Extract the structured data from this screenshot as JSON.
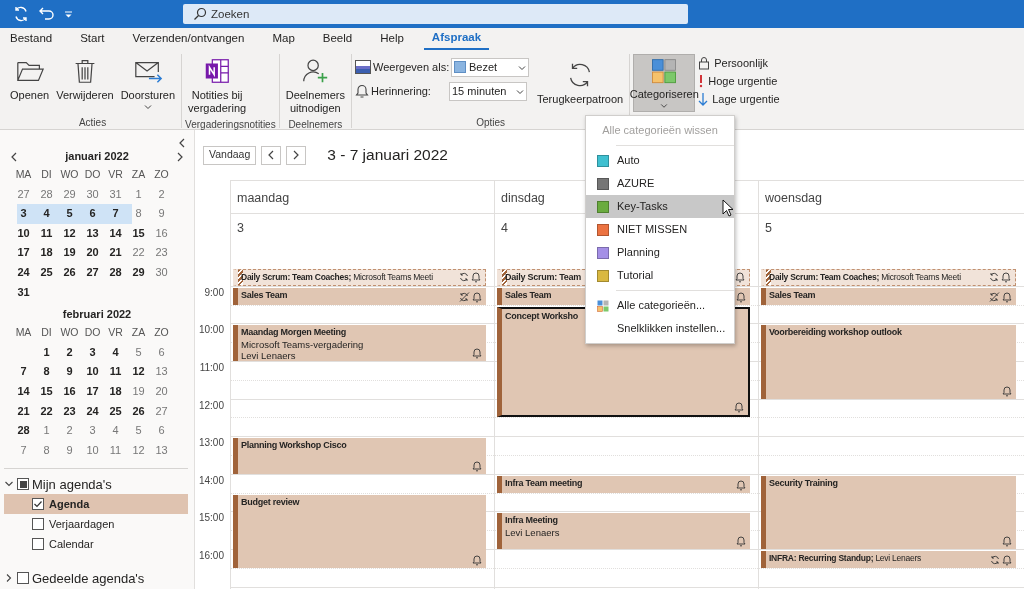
{
  "titlebar": {
    "search": {
      "placeholder": "Zoeken"
    }
  },
  "tabs": [
    {
      "label": "Bestand",
      "selected": false
    },
    {
      "label": "Start",
      "selected": false
    },
    {
      "label": "Verzenden/ontvangen",
      "selected": false
    },
    {
      "label": "Map",
      "selected": false
    },
    {
      "label": "Beeld",
      "selected": false
    },
    {
      "label": "Help",
      "selected": false
    },
    {
      "label": "Afspraak",
      "selected": true
    }
  ],
  "ribbon": {
    "groups": [
      {
        "kind": "large",
        "label": "Acties",
        "buttons": [
          {
            "kind": "open",
            "label": "Openen",
            "caret": false,
            "pressed": false
          },
          {
            "kind": "delete",
            "label": "Verwijderen",
            "caret": false,
            "pressed": false
          },
          {
            "kind": "forward",
            "label": "Doorsturen",
            "caret": true,
            "pressed": false
          }
        ]
      },
      {
        "kind": "large",
        "label": "Vergaderingsnotities",
        "buttons": [
          {
            "kind": "notes",
            "label": "Notities bij\nvergadering",
            "caret": false,
            "pressed": false
          }
        ]
      },
      {
        "kind": "large",
        "label": "Deelnemers",
        "buttons": [
          {
            "kind": "invite",
            "label": "Deelnemers\nuitnodigen",
            "caret": false,
            "pressed": false
          }
        ]
      },
      {
        "kind": "options",
        "label": "Opties",
        "fields": [
          {
            "kind": "show-as",
            "label": "Weergeven als:",
            "value": "Bezet"
          },
          {
            "kind": "reminder",
            "label": "Herinnering:",
            "value": "15 minuten"
          }
        ],
        "buttons": [
          {
            "kind": "recurrence",
            "label": "Terugkeerpatroon",
            "caret": false,
            "pressed": false
          }
        ]
      },
      {
        "kind": "categorize",
        "buttons": [
          {
            "kind": "categorize",
            "label": "Categoriseren",
            "caret": true,
            "pressed": true
          }
        ],
        "small_buttons": [
          {
            "kind": "private",
            "label": "Persoonlijk"
          },
          {
            "kind": "high",
            "label": "Hoge urgentie"
          },
          {
            "kind": "low",
            "label": "Lage urgentie"
          }
        ]
      }
    ]
  },
  "category_menu": {
    "items": [
      {
        "kind": "command",
        "label": "Alle categorieën wissen",
        "disabled": true,
        "hovered": false
      },
      {
        "kind": "separator"
      },
      {
        "kind": "category",
        "label": "Auto",
        "color": "#3fc0d0",
        "hovered": false
      },
      {
        "kind": "category",
        "label": "AZURE",
        "color": "#767676",
        "hovered": false
      },
      {
        "kind": "category",
        "label": "Key-Tasks",
        "color": "#6aab3f",
        "hovered": true
      },
      {
        "kind": "category",
        "label": "NIET MISSEN",
        "color": "#ec7341",
        "hovered": false
      },
      {
        "kind": "category",
        "label": "Planning",
        "color": "#a48fe6",
        "hovered": false
      },
      {
        "kind": "category",
        "label": "Tutorial",
        "color": "#d9b840",
        "hovered": false
      },
      {
        "kind": "separator"
      },
      {
        "kind": "all",
        "label": "Alle categorieën...",
        "disabled": false,
        "hovered": false
      },
      {
        "kind": "command",
        "label": "Snelklikken instellen...",
        "disabled": false,
        "hovered": false
      }
    ]
  },
  "sidebar": {
    "months": [
      {
        "title": "januari 2022",
        "weekdays": [
          "MA",
          "DI",
          "WO",
          "DO",
          "VR",
          "ZA",
          "ZO"
        ],
        "weeks": [
          {
            "selected": false,
            "days": [
              {
                "d": "27",
                "bold": false
              },
              {
                "d": "28",
                "bold": false
              },
              {
                "d": "29",
                "bold": false
              },
              {
                "d": "30",
                "bold": false
              },
              {
                "d": "31",
                "bold": false
              },
              {
                "d": "1",
                "bold": false
              },
              {
                "d": "2",
                "bold": false
              }
            ]
          },
          {
            "selected": true,
            "days": [
              {
                "d": "3",
                "bold": true
              },
              {
                "d": "4",
                "bold": true
              },
              {
                "d": "5",
                "bold": true
              },
              {
                "d": "6",
                "bold": true
              },
              {
                "d": "7",
                "bold": true
              },
              {
                "d": "8",
                "bold": false
              },
              {
                "d": "9",
                "bold": false
              }
            ]
          },
          {
            "selected": false,
            "days": [
              {
                "d": "10",
                "bold": true
              },
              {
                "d": "11",
                "bold": true
              },
              {
                "d": "12",
                "bold": true
              },
              {
                "d": "13",
                "bold": true
              },
              {
                "d": "14",
                "bold": true
              },
              {
                "d": "15",
                "bold": true
              },
              {
                "d": "16",
                "bold": false
              }
            ]
          },
          {
            "selected": false,
            "days": [
              {
                "d": "17",
                "bold": true
              },
              {
                "d": "18",
                "bold": true
              },
              {
                "d": "19",
                "bold": true
              },
              {
                "d": "20",
                "bold": true
              },
              {
                "d": "21",
                "bold": true
              },
              {
                "d": "22",
                "bold": false
              },
              {
                "d": "23",
                "bold": false
              }
            ]
          },
          {
            "selected": false,
            "days": [
              {
                "d": "24",
                "bold": true
              },
              {
                "d": "25",
                "bold": true
              },
              {
                "d": "26",
                "bold": true
              },
              {
                "d": "27",
                "bold": true
              },
              {
                "d": "28",
                "bold": true
              },
              {
                "d": "29",
                "bold": true
              },
              {
                "d": "30",
                "bold": false
              }
            ]
          },
          {
            "selected": false,
            "days": [
              {
                "d": "31",
                "bold": true
              }
            ]
          }
        ]
      },
      {
        "title": "februari 2022",
        "weekdays": [
          "MA",
          "DI",
          "WO",
          "DO",
          "VR",
          "ZA",
          "ZO"
        ],
        "weeks": [
          {
            "selected": false,
            "days": [
              {
                "d": "1",
                "bold": true
              },
              {
                "d": "2",
                "bold": true
              },
              {
                "d": "3",
                "bold": true
              },
              {
                "d": "4",
                "bold": true
              },
              {
                "d": "5",
                "bold": false
              },
              {
                "d": "6",
                "bold": false
              }
            ]
          },
          {
            "selected": false,
            "days": [
              {
                "d": "7",
                "bold": true
              },
              {
                "d": "8",
                "bold": true
              },
              {
                "d": "9",
                "bold": true
              },
              {
                "d": "10",
                "bold": true
              },
              {
                "d": "11",
                "bold": true
              },
              {
                "d": "12",
                "bold": true
              },
              {
                "d": "13",
                "bold": false
              }
            ]
          },
          {
            "selected": false,
            "days": [
              {
                "d": "14",
                "bold": true
              },
              {
                "d": "15",
                "bold": true
              },
              {
                "d": "16",
                "bold": true
              },
              {
                "d": "17",
                "bold": true
              },
              {
                "d": "18",
                "bold": true
              },
              {
                "d": "19",
                "bold": false
              },
              {
                "d": "20",
                "bold": false
              }
            ]
          },
          {
            "selected": false,
            "days": [
              {
                "d": "21",
                "bold": true
              },
              {
                "d": "22",
                "bold": true
              },
              {
                "d": "23",
                "bold": true
              },
              {
                "d": "24",
                "bold": true
              },
              {
                "d": "25",
                "bold": true
              },
              {
                "d": "26",
                "bold": true
              },
              {
                "d": "27",
                "bold": false
              }
            ]
          },
          {
            "selected": false,
            "days": [
              {
                "d": "28",
                "bold": true
              },
              {
                "d": "1",
                "bold": false
              },
              {
                "d": "2",
                "bold": false
              },
              {
                "d": "3",
                "bold": false
              },
              {
                "d": "4",
                "bold": false
              },
              {
                "d": "5",
                "bold": false
              },
              {
                "d": "6",
                "bold": false
              }
            ]
          },
          {
            "selected": false,
            "days": [
              {
                "d": "7",
                "bold": false
              },
              {
                "d": "8",
                "bold": false
              },
              {
                "d": "9",
                "bold": false
              },
              {
                "d": "10",
                "bold": false
              },
              {
                "d": "11",
                "bold": false
              },
              {
                "d": "12",
                "bold": false
              },
              {
                "d": "13",
                "bold": false
              }
            ]
          }
        ]
      }
    ],
    "calendar_groups": [
      {
        "label": "Mijn agenda's",
        "expanded": true,
        "indeterminate": true,
        "children": [
          {
            "label": "Agenda",
            "checked": true,
            "selected": true
          },
          {
            "label": "Verjaardagen",
            "checked": false,
            "selected": false
          },
          {
            "label": "Calendar",
            "checked": false,
            "selected": false
          }
        ]
      },
      {
        "label": "Gedeelde agenda's",
        "expanded": false,
        "indeterminate": false
      }
    ]
  },
  "calendar": {
    "today_button": "Vandaag",
    "title": "3 - 7 januari 2022",
    "time_labels": [
      "9:00",
      "10:00",
      "11:00",
      "12:00",
      "13:00",
      "14:00",
      "15:00",
      "16:00"
    ],
    "days": [
      {
        "name": "maandag",
        "date": "3",
        "slots": [
          {
            "kind": "appointment",
            "title": "Daily Scrum: Team Coaches;",
            "note": "Microsoft Teams Meeti",
            "tentative": true,
            "selected": false,
            "icons": [
              {
                "kind": "recurring"
              },
              {
                "kind": "reminder"
              }
            ]
          },
          {
            "kind": "appointment",
            "title": "Sales Team",
            "tentative": false,
            "selected": false,
            "icons": [
              {
                "kind": "exception"
              },
              {
                "kind": "reminder"
              }
            ]
          },
          {
            "kind": "free"
          },
          {
            "kind": "appointment",
            "title": "Maandag Morgen Meeting",
            "details": [
              "Microsoft Teams-vergadering",
              "Levi Lenaers"
            ],
            "tentative": false,
            "selected": false,
            "icons": [
              {
                "kind": "reminder"
              }
            ]
          },
          {
            "kind": "continued"
          },
          {
            "kind": "free"
          },
          {
            "kind": "free"
          },
          {
            "kind": "free"
          },
          {
            "kind": "free"
          },
          {
            "kind": "appointment",
            "title": "Planning Workshop Cisco",
            "tentative": false,
            "selected": false,
            "icons": [
              {
                "kind": "reminder"
              }
            ]
          },
          {
            "kind": "continued"
          },
          {
            "kind": "free"
          },
          {
            "kind": "appointment",
            "title": "Budget review",
            "tentative": false,
            "selected": false,
            "icons": [
              {
                "kind": "reminder"
              }
            ]
          },
          {
            "kind": "continued"
          },
          {
            "kind": "continued"
          },
          {
            "kind": "continued"
          },
          {
            "kind": "free"
          }
        ]
      },
      {
        "name": "dinsdag",
        "date": "4",
        "slots": [
          {
            "kind": "appointment",
            "title": "Daily Scrum: Team",
            "tentative": true,
            "selected": false,
            "icons": [
              {
                "kind": "reminder"
              }
            ]
          },
          {
            "kind": "appointment",
            "title": "Sales Team",
            "tentative": false,
            "selected": false,
            "icons": [
              {
                "kind": "reminder"
              }
            ]
          },
          {
            "kind": "appointment",
            "title": "Concept Worksho",
            "tentative": false,
            "selected": true,
            "icons": [
              {
                "kind": "reminder"
              }
            ]
          },
          {
            "kind": "continued"
          },
          {
            "kind": "continued"
          },
          {
            "kind": "continued"
          },
          {
            "kind": "continued"
          },
          {
            "kind": "continued"
          },
          {
            "kind": "free"
          },
          {
            "kind": "free"
          },
          {
            "kind": "free"
          },
          {
            "kind": "appointment",
            "title": "Infra Team meeting",
            "tentative": false,
            "selected": false,
            "icons": [
              {
                "kind": "reminder"
              }
            ]
          },
          {
            "kind": "free"
          },
          {
            "kind": "appointment",
            "title": "Infra Meeting",
            "details": [
              "Levi Lenaers"
            ],
            "tentative": false,
            "selected": false,
            "icons": [
              {
                "kind": "reminder"
              }
            ]
          },
          {
            "kind": "continued"
          },
          {
            "kind": "free"
          },
          {
            "kind": "free"
          }
        ]
      },
      {
        "name": "woensdag",
        "date": "5",
        "slots": [
          {
            "kind": "appointment",
            "title": "Daily Scrum: Team Coaches;",
            "note": "Microsoft Teams Meeti",
            "tentative": true,
            "selected": false,
            "icons": [
              {
                "kind": "recurring"
              },
              {
                "kind": "reminder"
              }
            ]
          },
          {
            "kind": "appointment",
            "title": "Sales Team",
            "tentative": false,
            "selected": false,
            "icons": [
              {
                "kind": "exception"
              },
              {
                "kind": "reminder"
              }
            ]
          },
          {
            "kind": "free"
          },
          {
            "kind": "appointment",
            "title": "Voorbereiding workshop outlook",
            "tentative": false,
            "selected": false,
            "icons": [
              {
                "kind": "reminder"
              }
            ]
          },
          {
            "kind": "continued"
          },
          {
            "kind": "continued"
          },
          {
            "kind": "continued"
          },
          {
            "kind": "free"
          },
          {
            "kind": "free"
          },
          {
            "kind": "free"
          },
          {
            "kind": "free"
          },
          {
            "kind": "appointment",
            "title": "Security Training",
            "tentative": false,
            "selected": false,
            "icons": [
              {
                "kind": "reminder"
              }
            ]
          },
          {
            "kind": "continued"
          },
          {
            "kind": "continued"
          },
          {
            "kind": "continued"
          },
          {
            "kind": "appointment",
            "title": "INFRA: Recurring  Standup;",
            "note": "Levi Lenaers",
            "tentative": false,
            "selected": false,
            "icons": [
              {
                "kind": "recurring"
              },
              {
                "kind": "reminder"
              }
            ]
          },
          {
            "kind": "free"
          }
        ]
      }
    ]
  }
}
